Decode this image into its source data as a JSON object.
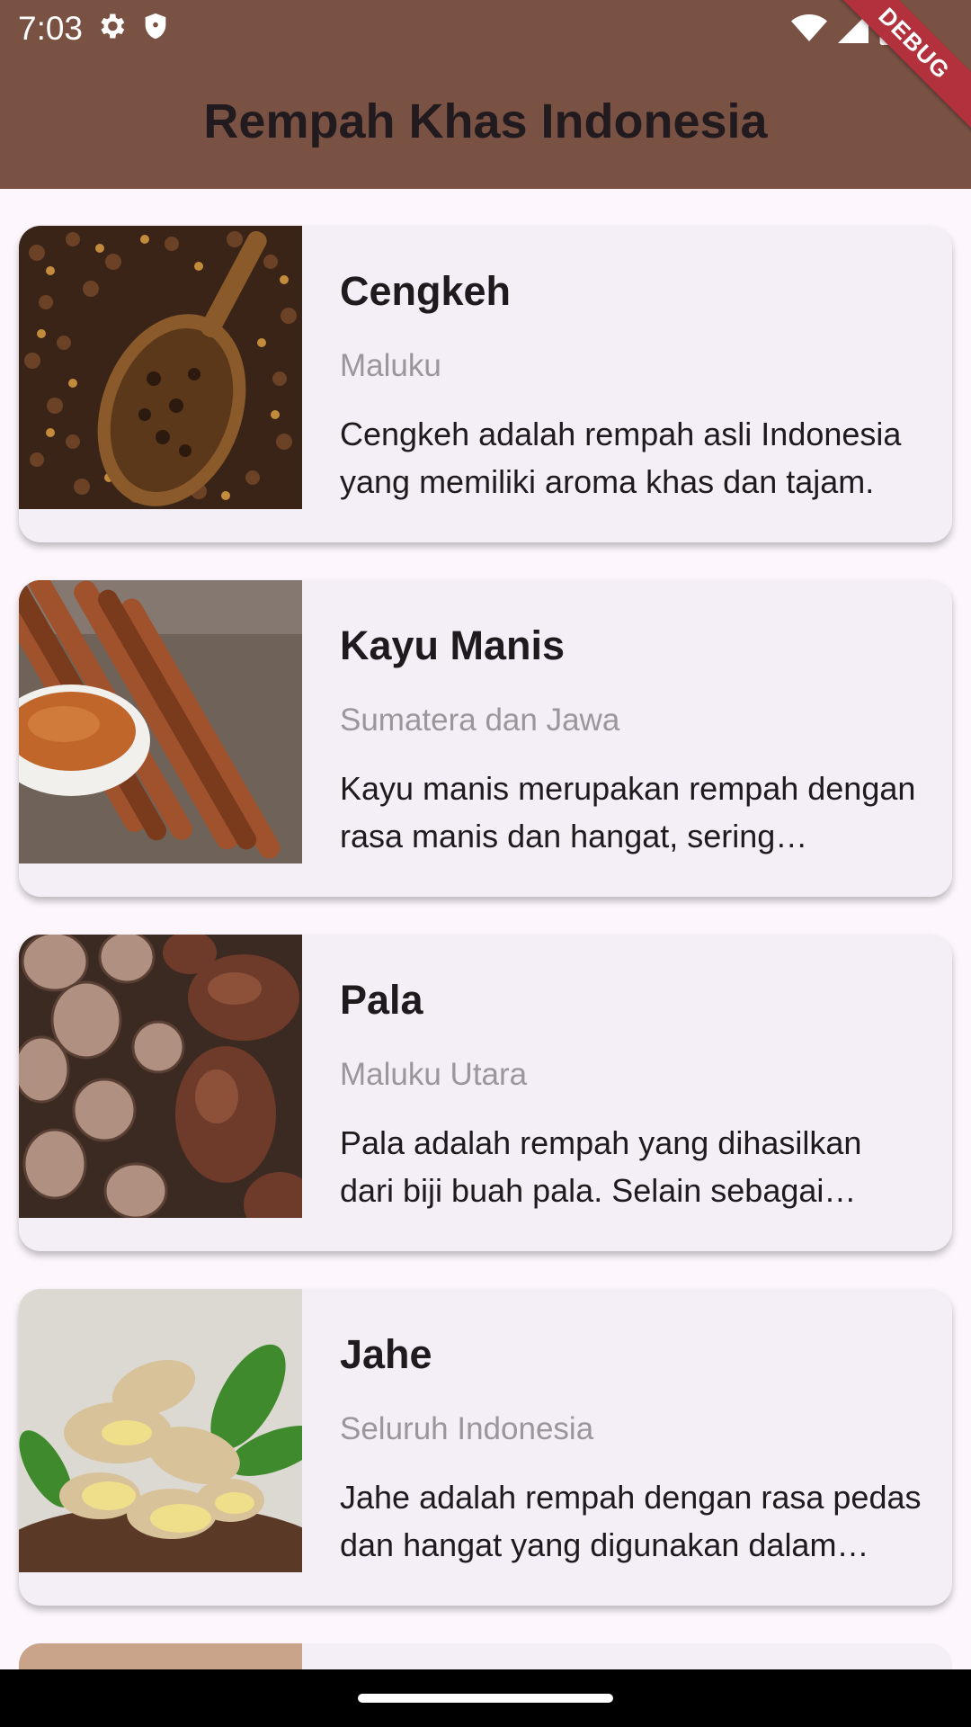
{
  "status_bar": {
    "time": "7:03",
    "left_icons": [
      "gear-icon",
      "shield-icon"
    ],
    "right_icons": [
      "wifi-icon",
      "signal-icon",
      "battery-icon"
    ]
  },
  "app_bar": {
    "title": "Rempah Khas Indonesia",
    "debug_banner": "DEBUG",
    "background_color": "#7a5244"
  },
  "spices": [
    {
      "name": "Cengkeh",
      "origin": "Maluku",
      "description": "Cengkeh adalah rempah asli Indonesia yang memiliki aroma khas dan tajam.",
      "image": "cloves-photo"
    },
    {
      "name": "Kayu Manis",
      "origin": "Sumatera dan Jawa",
      "description": "Kayu manis merupakan rempah dengan rasa manis dan hangat, sering digunakan.",
      "image": "cinnamon-photo"
    },
    {
      "name": "Pala",
      "origin": "Maluku Utara",
      "description": "Pala adalah rempah yang dihasilkan dari biji buah pala. Selain sebagai bumbu.",
      "image": "nutmeg-photo"
    },
    {
      "name": "Jahe",
      "origin": "Seluruh Indonesia",
      "description": "Jahe adalah rempah dengan rasa pedas dan hangat yang digunakan dalam masakan.",
      "image": "ginger-photo"
    }
  ]
}
